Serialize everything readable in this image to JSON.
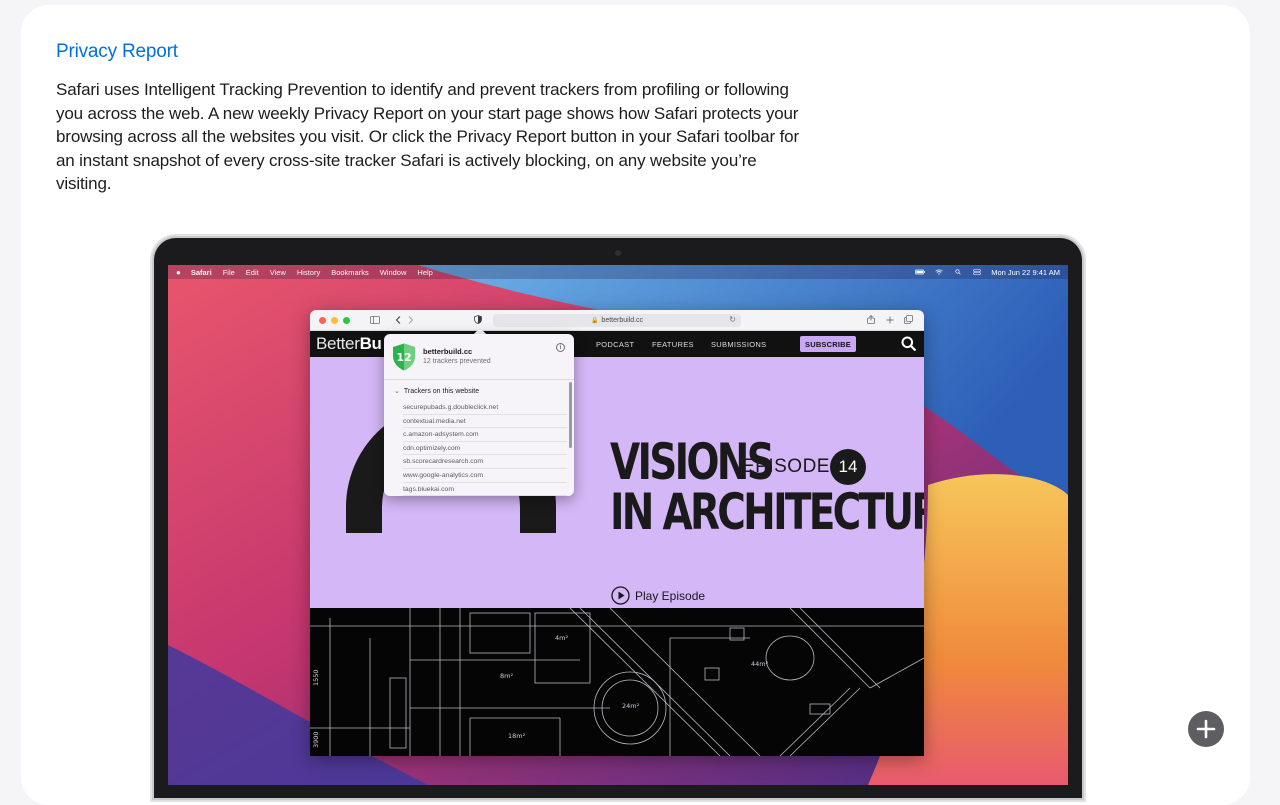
{
  "card": {
    "title": "Privacy Report",
    "body": "Safari uses Intelligent Tracking Prevention to identify and prevent trackers from profiling or following you across the web. A new weekly Privacy Report on your start page shows how Safari protects your browsing across all the websites you visit. Or click the Privacy Report button in your Safari toolbar for an instant snapshot of every cross-site tracker Safari is actively blocking, on any website you’re visiting."
  },
  "menubar": {
    "items": [
      "Safari",
      "File",
      "Edit",
      "View",
      "History",
      "Bookmarks",
      "Window",
      "Help"
    ],
    "clock": "Mon Jun 22  9:41 AM"
  },
  "safari": {
    "url": "betterbuild.cc",
    "traffic_lights": [
      "#ff5f57",
      "#febc2e",
      "#28c840"
    ]
  },
  "site": {
    "logo_light": "Better",
    "logo_bold": "Bu",
    "nav": [
      "PODCAST",
      "FEATURES",
      "SUBMISSIONS"
    ],
    "subscribe": "SUBSCRIBE",
    "hero_line1": "VISIONS",
    "hero_line2": "IN ARCHITECTURE",
    "episode_label": "EPISODE",
    "episode_number": "14",
    "play": "Play Episode",
    "accent": "#d4b7f7"
  },
  "privacy_popover": {
    "count": "12",
    "site": "betterbuild.cc",
    "summary": "12 trackers prevented",
    "section": "Trackers on this website",
    "trackers": [
      "securepubads.g.doubleclick.net",
      "contextual.media.net",
      "c.amazon-adsystem.com",
      "cdn.optimizely.com",
      "sb.scorecardresearch.com",
      "www.google-analytics.com",
      "tags.bluekai.com"
    ]
  },
  "blueprint_labels": {
    "a": "4m²",
    "b": "8m²",
    "c": "24m²",
    "d": "44m²",
    "e": "18m²",
    "f": "1550",
    "g": "3900"
  },
  "plus_button": {
    "icon": "plus-icon"
  }
}
